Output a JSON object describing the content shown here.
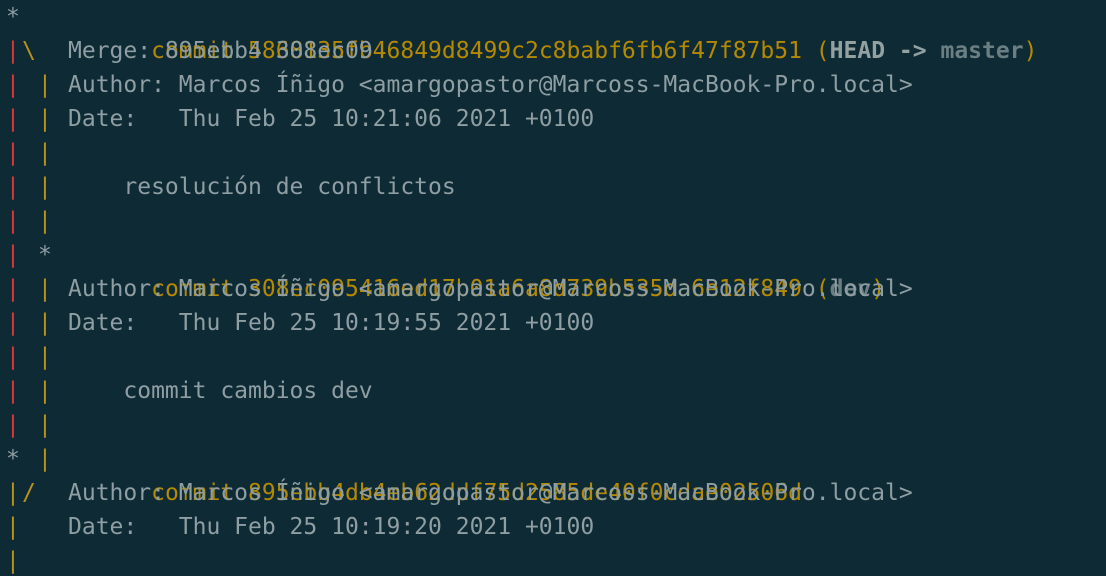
{
  "commits": [
    {
      "commit_label": "commit",
      "hash": "5868135fb46849d8499c2c8babf6fb6f47f87b51",
      "ref_open": "(",
      "head": "HEAD",
      "arrow": "->",
      "branch": "master",
      "ref_close": ")",
      "merge": "Merge: 895ebb4 308ec09",
      "author": "Author: Marcos Íñigo <amargopastor@Marcoss-MacBook-Pro.local>",
      "date": "Date:   Thu Feb 25 10:21:06 2021 +0100",
      "message": "    resolución de conflictos"
    },
    {
      "commit_label": "commit",
      "hash": "308ec095416ed17b01a6a8d739b535da6e12f849",
      "ref_open": "(",
      "branch": "dev",
      "ref_close": ")",
      "author": "Author: Marcos Íñigo <amargopastor@Marcoss-MacBook-Pro.local>",
      "date": "Date:   Thu Feb 25 10:19:55 2021 +0100",
      "message": "    commit cambios dev"
    },
    {
      "commit_label": "commit",
      "hash": "895ebb4db4eb62ddf75d2585de40f0cdae02506d",
      "author": "Author: Marcos Íñigo <amargopastor@Marcoss-MacBook-Pro.local>",
      "date": "Date:   Thu Feb 25 10:19:20 2021 +0100"
    }
  ],
  "graph_glyphs": {
    "star": "*",
    "pipe": "|",
    "merge_left": "\\",
    "merge_right": "/"
  },
  "colors": {
    "background": "#0e2a35",
    "hash": "#b58900",
    "graph_red": "#d8383a",
    "graph_yellow": "#b79220",
    "text": "#8e9ea2"
  }
}
